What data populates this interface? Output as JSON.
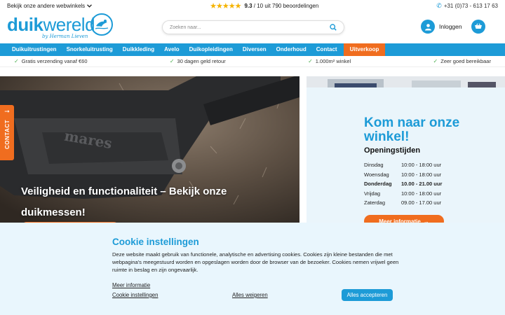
{
  "topbar": {
    "webshops_label": "Bekijk onze andere webwinkels",
    "rating_score": "9.3",
    "rating_rest": " / 10 uit 790 beoordelingen",
    "rating_stars": 5,
    "phone": "+31 (0)73 - 613 17 63"
  },
  "header": {
    "logo_text_bold": "duik",
    "logo_text_thin": "wereld",
    "logo_sub": "by Herman Lieven",
    "search_placeholder": "Zoeken naar...",
    "login_label": "Inloggen"
  },
  "nav": {
    "items": [
      {
        "label": "Duikuitrustingen"
      },
      {
        "label": "Snorkeluitrusting"
      },
      {
        "label": "Duikkleding"
      },
      {
        "label": "Avelo"
      },
      {
        "label": "Duikopleidingen"
      },
      {
        "label": "Diversen"
      },
      {
        "label": "Onderhoud"
      },
      {
        "label": "Contact"
      },
      {
        "label": "Uitverkoop"
      }
    ]
  },
  "usps": [
    {
      "label": "Gratis verzending vanaf €60"
    },
    {
      "label": "30 dagen geld retour"
    },
    {
      "label": "1.000m² winkel"
    },
    {
      "label": "Zeer goed bereikbaar"
    }
  ],
  "hero": {
    "title": "Veiligheid en functionaliteit – Bekijk onze duikmessen!",
    "brand_text": "mares"
  },
  "store": {
    "title": "Kom naar onze winkel!",
    "subtitle": "Openingstijden",
    "hours": [
      {
        "day": "Dinsdag",
        "time": "10:00 - 18:00 uur"
      },
      {
        "day": "Woensdag",
        "time": "10:00 - 18:00 uur"
      },
      {
        "day": "Donderdag",
        "time": "10.00 - 21.00 uur"
      },
      {
        "day": "Vrijdag",
        "time": "10:00 - 18:00 uur"
      },
      {
        "day": "Zaterdag",
        "time": "09.00 - 17.00 uur"
      }
    ],
    "button_label": "Meer informatie"
  },
  "contact_tab": {
    "label": "CONTACT"
  },
  "cookie": {
    "title": "Cookie instellingen",
    "text": "Deze website maakt gebruik van functionele, analytische en advertising cookies. Cookies zijn kleine bestanden die met webpagina's meegestuurd worden en opgeslagen worden door de browser van de bezoeker. Cookies nemen vrijwel geen ruimte in beslag en zijn ongevaarlijk.",
    "more_info": "Meer informatie",
    "settings": "Cookie instellingen",
    "reject": "Alles weigeren",
    "accept": "Alles accepteren"
  },
  "colors": {
    "brand_blue": "#1d9bd7",
    "accent_orange": "#f06d1f",
    "cookie_bg": "#e9f6fd"
  }
}
